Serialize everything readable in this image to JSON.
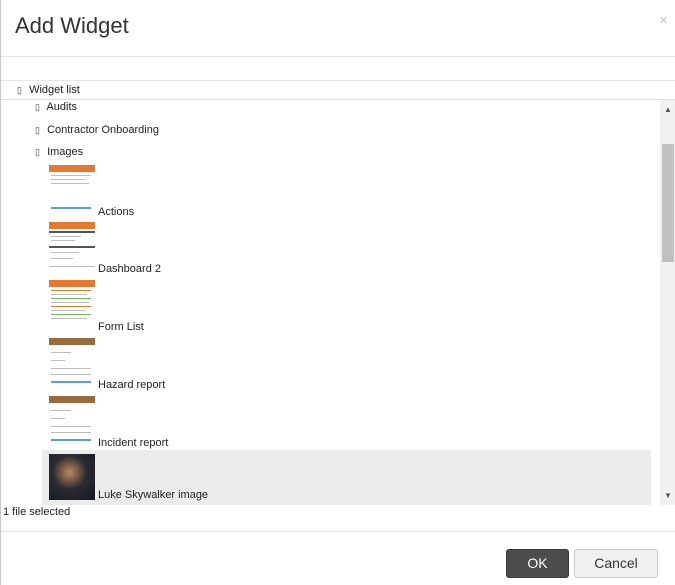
{
  "dialog": {
    "title": "Add Widget",
    "close_glyph": "×",
    "root_glyph": "▯",
    "root_label": "Widget list",
    "folders": [
      {
        "glyph": "▯",
        "label": "Audits"
      },
      {
        "glyph": "▯",
        "label": "Contractor Onboarding"
      },
      {
        "glyph": "▯",
        "label": "Images"
      }
    ],
    "images": [
      {
        "label": "Actions",
        "thumbnail": "actions-thumbnail"
      },
      {
        "label": "Dashboard 2",
        "thumbnail": "dashboard-thumbnail"
      },
      {
        "label": "Form List",
        "thumbnail": "form-list-thumbnail"
      },
      {
        "label": "Hazard report",
        "thumbnail": "hazard-report-thumbnail"
      },
      {
        "label": "Incident report",
        "thumbnail": "incident-report-thumbnail"
      },
      {
        "label": "Luke Skywalker image",
        "thumbnail": "portrait-photo",
        "selected": true
      }
    ],
    "scroll_up_glyph": "▲",
    "scroll_down_glyph": "▼",
    "status": "1 file selected",
    "ok_label": "OK",
    "cancel_label": "Cancel"
  },
  "colors": {
    "thumbnail_bar": "#e6792e",
    "selected_row": "#ececec",
    "ok_button": "#4d4d4d"
  }
}
